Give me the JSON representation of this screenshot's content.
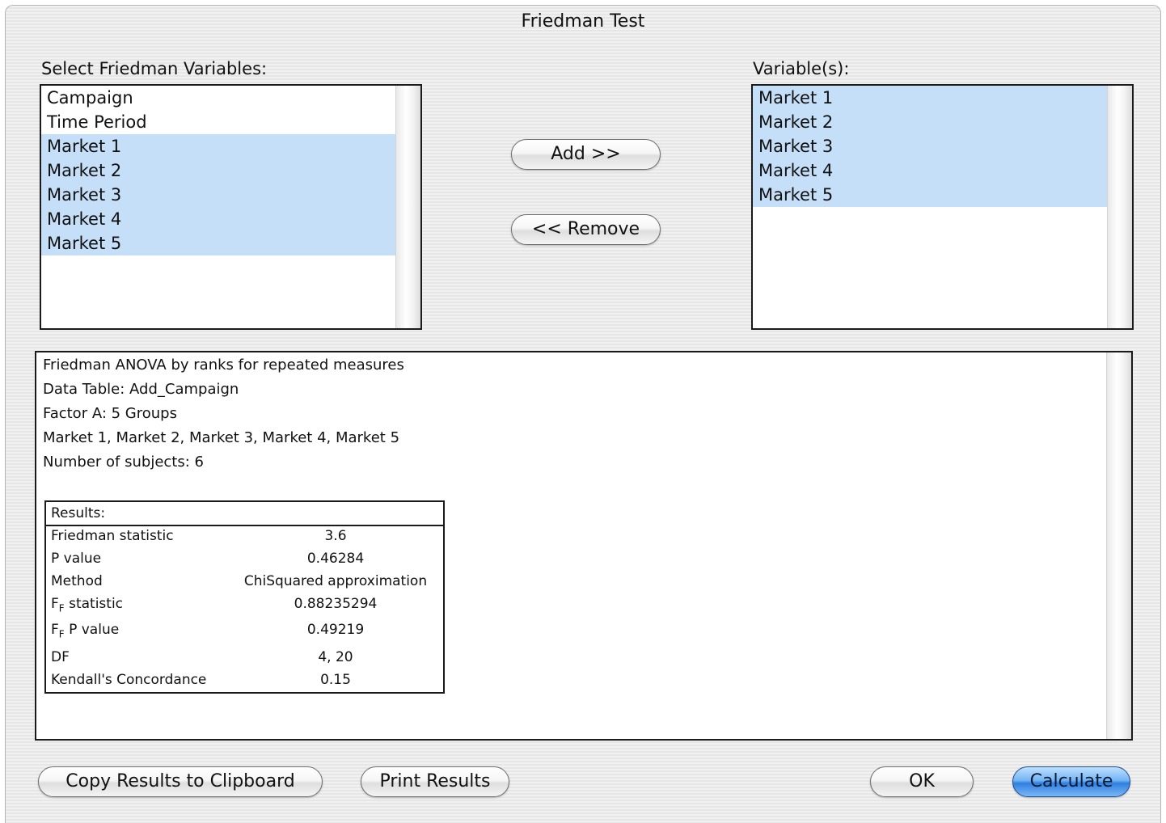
{
  "window": {
    "title": "Friedman Test"
  },
  "left_list": {
    "label": "Select Friedman Variables:",
    "items": [
      {
        "label": "Campaign",
        "selected": false
      },
      {
        "label": "Time Period",
        "selected": false
      },
      {
        "label": "Market 1",
        "selected": true
      },
      {
        "label": "Market 2",
        "selected": true
      },
      {
        "label": "Market 3",
        "selected": true
      },
      {
        "label": "Market 4",
        "selected": true
      },
      {
        "label": "Market 5",
        "selected": true
      }
    ]
  },
  "right_list": {
    "label": "Variable(s):",
    "items": [
      {
        "label": "Market 1",
        "selected": true
      },
      {
        "label": "Market 2",
        "selected": true
      },
      {
        "label": "Market 3",
        "selected": true
      },
      {
        "label": "Market 4",
        "selected": true
      },
      {
        "label": "Market 5",
        "selected": true
      }
    ]
  },
  "buttons": {
    "add": "Add >>",
    "remove": "<< Remove",
    "copy": "Copy Results to Clipboard",
    "print": "Print Results",
    "ok": "OK",
    "calculate": "Calculate"
  },
  "results": {
    "lines": [
      "Friedman ANOVA by ranks for repeated measures",
      "Data Table: Add_Campaign",
      "Factor A: 5 Groups",
      "Market 1,  Market 2,  Market 3,  Market 4,  Market 5",
      "Number of subjects: 6"
    ],
    "table_header": "Results:",
    "rows": [
      {
        "label": "Friedman statistic",
        "value": "3.6"
      },
      {
        "label": "P value",
        "value": "0.46284"
      },
      {
        "label": "Method",
        "value": "ChiSquared approximation"
      },
      {
        "label": "F",
        "sub": "F",
        "suffix": " statistic",
        "value": "0.88235294"
      },
      {
        "label": "F",
        "sub": "F",
        "suffix": "  P value",
        "value": "0.49219"
      },
      {
        "label": "DF",
        "value": "4,  20"
      },
      {
        "label": "Kendall's Concordance",
        "value": "0.15"
      }
    ]
  },
  "colors": {
    "selection": "#c5dff9",
    "default_button": "#2f7fe0"
  }
}
